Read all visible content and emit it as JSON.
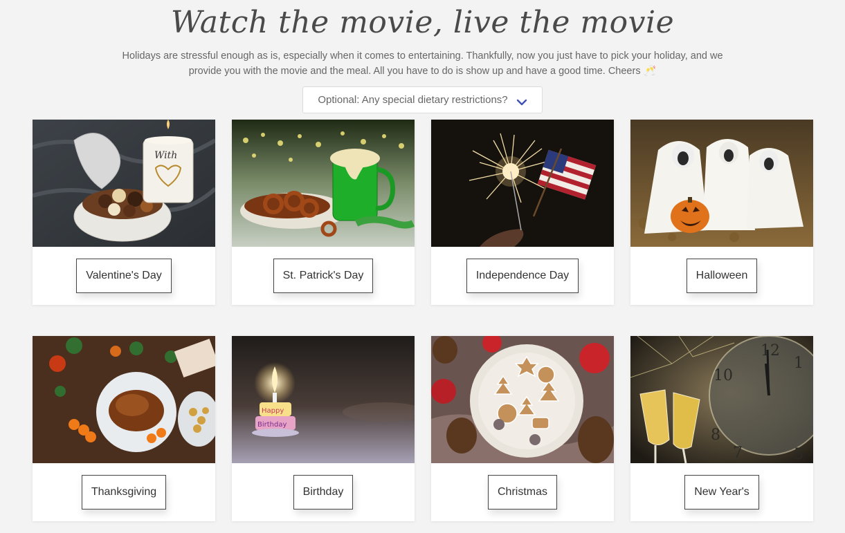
{
  "header": {
    "title": "Watch the movie, live the movie",
    "subtitle_line1": "Holidays are stressful enough as is, especially when it comes to entertaining. Thankfully, now you just have to pick your holiday, and we",
    "subtitle_line2": "provide you with the movie and the meal. All you have to do is show up and have a good time. Cheers",
    "cheers_emoji": "🥂"
  },
  "diet_select": {
    "label": "Optional: Any special dietary restrictions?",
    "icon": "chevron-down-icon",
    "icon_color": "#3f51b5"
  },
  "holidays": [
    {
      "label": "Valentine's Day",
      "image": "valentines-chocolates-candle-photo"
    },
    {
      "label": "St. Patrick's Day",
      "image": "green-beer-pretzels-photo"
    },
    {
      "label": "Independence Day",
      "image": "sparkler-american-flag-photo"
    },
    {
      "label": "Halloween",
      "image": "dogs-ghost-costumes-pumpkin-photo"
    },
    {
      "label": "Thanksgiving",
      "image": "roast-turkey-table-photo"
    },
    {
      "label": "Birthday",
      "image": "birthday-candle-cake-photo"
    },
    {
      "label": "Christmas",
      "image": "christmas-cookies-plate-photo"
    },
    {
      "label": "New Year's",
      "image": "champagne-clock-photo"
    }
  ],
  "colors": {
    "background": "#f3f3f3",
    "card": "#ffffff",
    "button_border": "#444444"
  }
}
